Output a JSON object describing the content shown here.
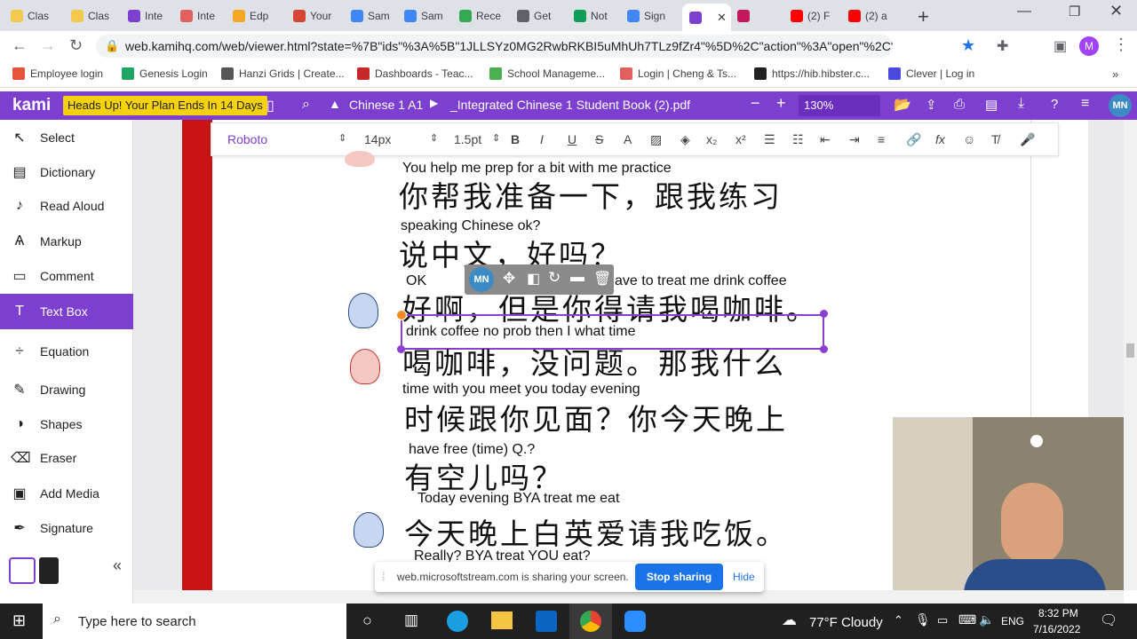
{
  "tabs": [
    {
      "label": "Clas",
      "color": "#f2c94c"
    },
    {
      "label": "Clas",
      "color": "#f2c94c"
    },
    {
      "label": "Inte",
      "color": "#7d3fd0"
    },
    {
      "label": "Inte",
      "color": "#e06060"
    },
    {
      "label": "Edp",
      "color": "#f5a623"
    },
    {
      "label": "Your",
      "color": "#d44638"
    },
    {
      "label": "Sam",
      "color": "#4285f4"
    },
    {
      "label": "Sam",
      "color": "#4285f4"
    },
    {
      "label": "Rece",
      "color": "#34a853"
    },
    {
      "label": "Get",
      "color": "#5f6368"
    },
    {
      "label": "Not",
      "color": "#0f9d58"
    },
    {
      "label": "Sign",
      "color": "#4285f4"
    },
    {
      "label": "",
      "color": "#7d3fd0"
    },
    {
      "label": "",
      "color": "#c2185b"
    },
    {
      "label": "(2) F",
      "color": "#ff0000"
    },
    {
      "label": "(2) a",
      "color": "#ff0000"
    }
  ],
  "url": "web.kamihq.com/web/viewer.html?state=%7B\"ids\"%3A%5B\"1JLLSYz0MG2RwbRKBI5uMhUh7TLz9fZr4\"%5D%2C\"action\"%3A\"open\"%2C\"u...",
  "bookmarks": [
    "Employee login",
    "Genesis Login",
    "Hanzi Grids | Create...",
    "Dashboards - Teac...",
    "School Manageme...",
    "Login | Cheng & Ts...",
    "https://hib.hibster.c...",
    "Clever | Log in"
  ],
  "kami": {
    "logo": "kami",
    "banner": "Heads Up! Your Plan Ends In 14 Days",
    "breadcrumb": "Chinese 1 A1",
    "filename": "_Integrated Chinese 1 Student Book (2).pdf",
    "zoom": "130%",
    "avatar": "MN"
  },
  "tools": [
    "Select",
    "Dictionary",
    "Read Aloud",
    "Markup",
    "Comment",
    "Text Box",
    "Equation",
    "Drawing",
    "Shapes",
    "Eraser",
    "Add Media",
    "Signature"
  ],
  "format": {
    "font": "Roboto",
    "size": "14px",
    "spacing": "1.5pt",
    "fontsize_select": "14"
  },
  "colors": {
    "accent": "#7d3fd0",
    "black": "#000000",
    "red": "#e60000",
    "orange": "#ff9900"
  },
  "content": {
    "en1": "You help  me    prep      for a bit            with me    practice",
    "zh1": "你帮我准备一下，跟我练习",
    "en2": "speaking Chinese  ok?",
    "zh2": "说中文，好吗？",
    "en3a": "OK",
    "en3b": "ave to treat me drink coffee",
    "zh3": "好啊，但是你得请我喝咖啡。",
    "box": "drink coffee              no prob                      then I        what time",
    "zh4": "喝咖啡，没问题。那我什么",
    "en5": "time          with you meet                         you today evening",
    "zh5": "时候跟你见面？你今天晚上",
    "en6": "have free (time) Q.?",
    "zh6": "有空儿吗？",
    "en7": "Today     evening   BYA                      treat me eat",
    "zh7": "今天晚上白英爱请我吃饭。",
    "en8": "Really?                          BYA       treat YOU eat?"
  },
  "share": {
    "text": "web.microsoftstream.com is sharing your screen.",
    "stop": "Stop sharing",
    "hide": "Hide"
  },
  "taskbar": {
    "search": "Type here to search",
    "weather": "77°F  Cloudy",
    "lang": "ENG",
    "time": "8:32 PM",
    "date": "7/16/2022"
  }
}
